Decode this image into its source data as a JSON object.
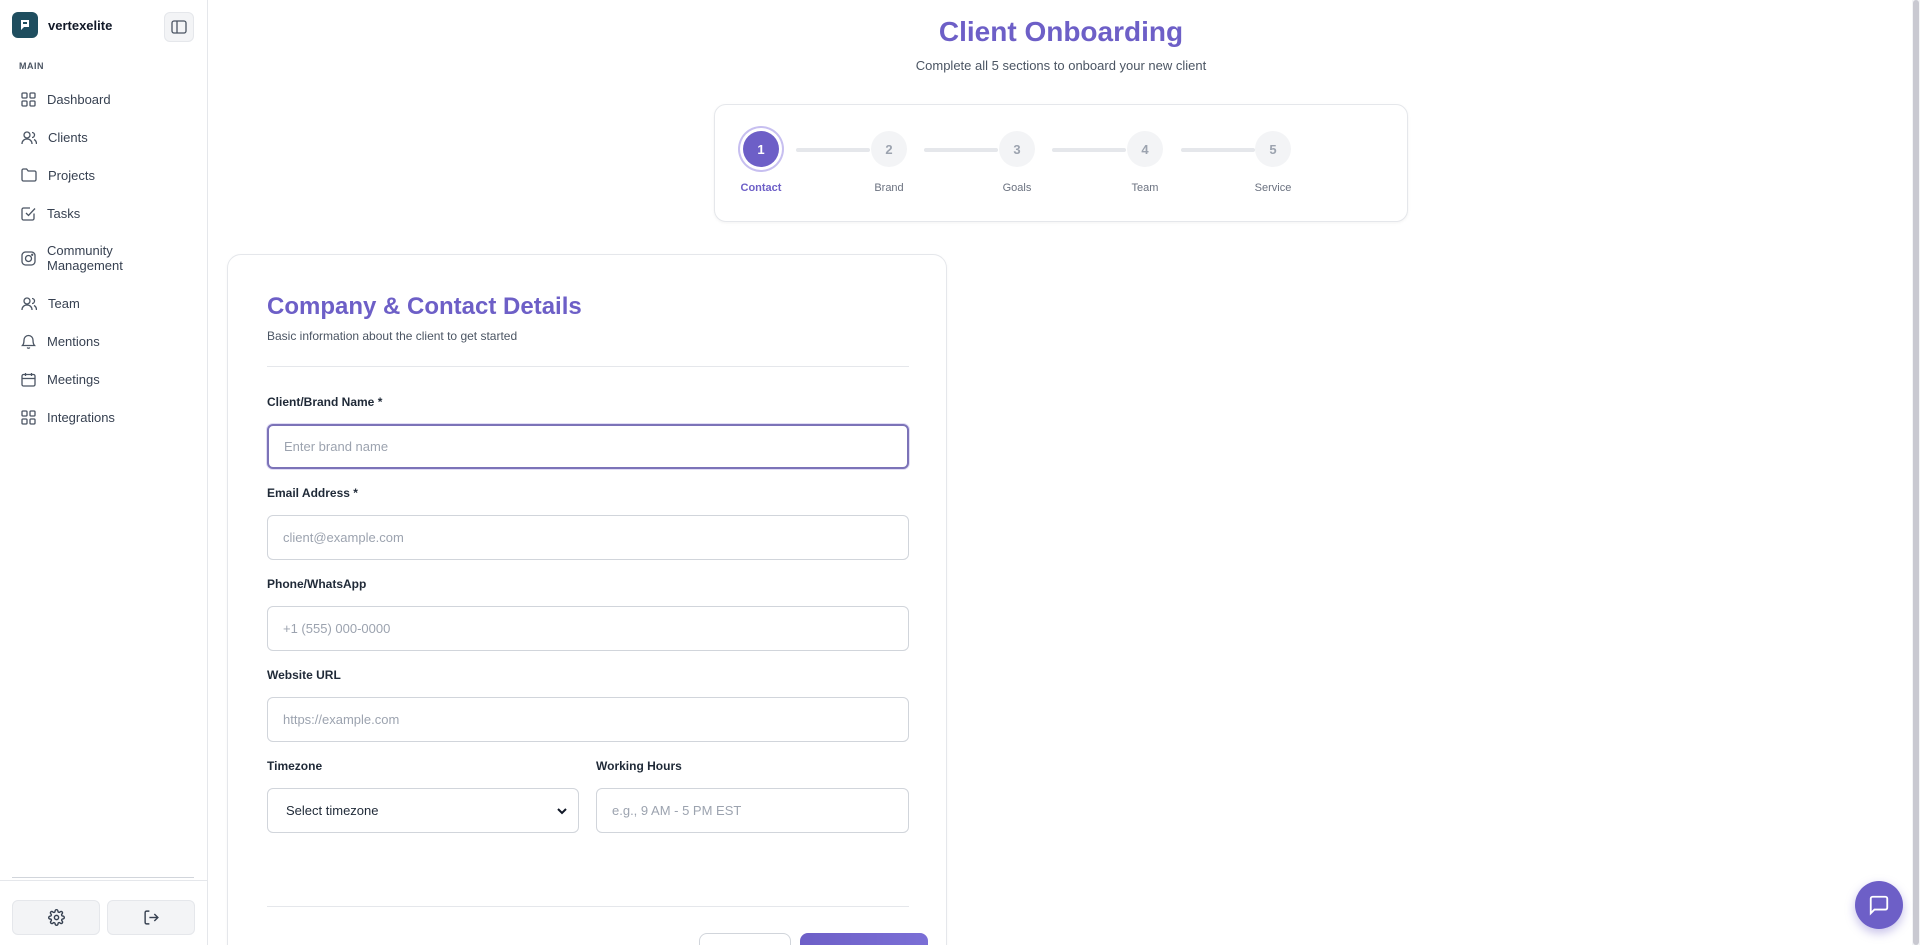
{
  "sidebar": {
    "brand": "vertexelite",
    "section_label": "MAIN",
    "items": [
      {
        "label": "Dashboard",
        "icon": "grid-icon"
      },
      {
        "label": "Clients",
        "icon": "users-icon"
      },
      {
        "label": "Projects",
        "icon": "folder-icon"
      },
      {
        "label": "Tasks",
        "icon": "check-square-icon"
      },
      {
        "label": "Community Management",
        "icon": "instagram-icon"
      },
      {
        "label": "Team",
        "icon": "users-icon"
      },
      {
        "label": "Mentions",
        "icon": "bell-icon"
      },
      {
        "label": "Meetings",
        "icon": "calendar-icon"
      },
      {
        "label": "Integrations",
        "icon": "apps-icon"
      }
    ]
  },
  "header": {
    "title": "Client Onboarding",
    "subtitle": "Complete all 5 sections to onboard your new client"
  },
  "stepper": {
    "active": 1,
    "steps": [
      {
        "number": "1",
        "label": "Contact"
      },
      {
        "number": "2",
        "label": "Brand"
      },
      {
        "number": "3",
        "label": "Goals"
      },
      {
        "number": "4",
        "label": "Team"
      },
      {
        "number": "5",
        "label": "Service"
      }
    ]
  },
  "form": {
    "title": "Company & Contact Details",
    "subtitle": "Basic information about the client to get started",
    "brand_name": {
      "label": "Client/Brand Name *",
      "placeholder": "Enter brand name",
      "value": ""
    },
    "email": {
      "label": "Email Address *",
      "placeholder": "client@example.com",
      "value": ""
    },
    "phone": {
      "label": "Phone/WhatsApp",
      "placeholder": "+1 (555) 000-0000",
      "value": ""
    },
    "website": {
      "label": "Website URL",
      "placeholder": "https://example.com",
      "value": ""
    },
    "timezone": {
      "label": "Timezone",
      "selected": "Select timezone"
    },
    "hours": {
      "label": "Working Hours",
      "placeholder": "e.g., 9 AM - 5 PM EST",
      "value": ""
    }
  },
  "colors": {
    "accent": "#6d5fc7",
    "brand_logo": "#1f4e5f"
  }
}
